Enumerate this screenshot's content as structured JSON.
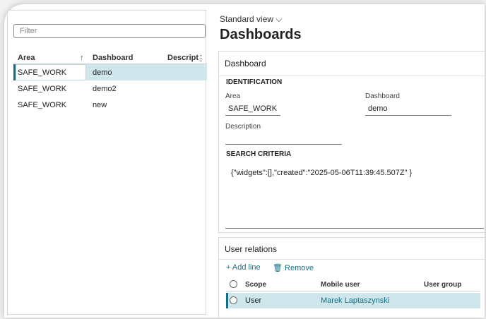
{
  "left_panel": {
    "filter_placeholder": "Filter",
    "columns": [
      "Area",
      "Dashboard",
      "Descript"
    ],
    "sort_indicator": "↑",
    "more_icon": "⋮",
    "rows": [
      {
        "area": "SAFE_WORK",
        "dashboard": "demo",
        "selected": true
      },
      {
        "area": "SAFE_WORK",
        "dashboard": "demo2",
        "selected": false
      },
      {
        "area": "SAFE_WORK",
        "dashboard": "new",
        "selected": false
      }
    ]
  },
  "header": {
    "view_label": "Standard view",
    "chevron": "⌵",
    "title": "Dashboards"
  },
  "dashboard_card": {
    "title": "Dashboard",
    "identification_heading": "IDENTIFICATION",
    "area_label": "Area",
    "area_value": "SAFE_WORK",
    "dashboard_label": "Dashboard",
    "dashboard_value": "demo",
    "description_label": "Description",
    "description_value": "",
    "search_criteria_heading": "SEARCH CRITERIA",
    "search_criteria_value": "{\"widgets\":[],\"created\":\"2025-05-06T11:39:45.507Z\" }"
  },
  "user_relations": {
    "title": "User relations",
    "add_line_label": "Add line",
    "remove_label": "Remove",
    "columns": [
      "Scope",
      "Mobile user",
      "User group"
    ],
    "rows": [
      {
        "scope": "User",
        "mobile_user": "Marek Laptaszynski",
        "user_group": ""
      }
    ]
  },
  "colors": {
    "accent": "#106f84",
    "selection": "#cfe6ec"
  }
}
